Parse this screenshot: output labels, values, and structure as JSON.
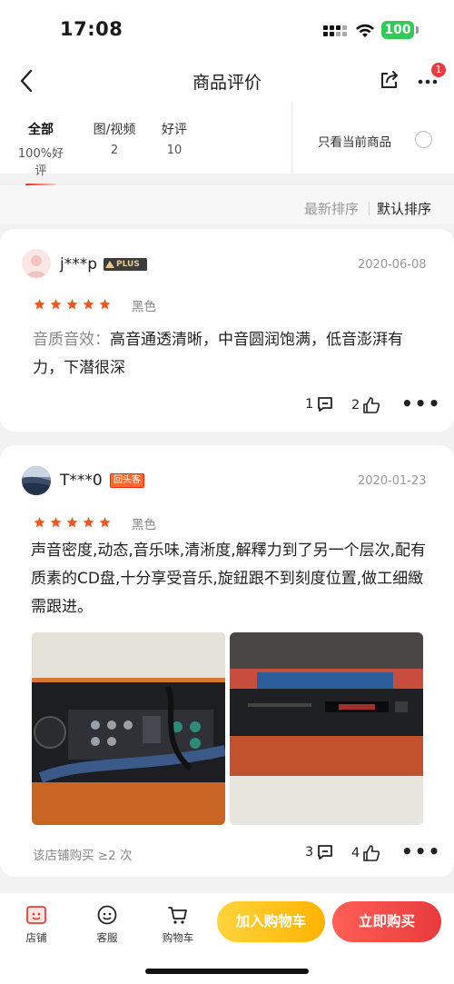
{
  "status": {
    "time": "17:08",
    "battery": "100"
  },
  "nav": {
    "title": "商品评价",
    "badge": "1"
  },
  "filters": {
    "tabs": [
      {
        "label": "全部",
        "count": "100%好评"
      },
      {
        "label": "图/视频",
        "count": "2"
      },
      {
        "label": "好评",
        "count": "10"
      }
    ],
    "only_current": "只看当前商品"
  },
  "sort": {
    "latest": "最新排序",
    "default": "默认排序"
  },
  "reviews": [
    {
      "user": "j***p",
      "badge": "PLUS",
      "date": "2020-06-08",
      "rating": 5,
      "color": "黑色",
      "content_prefix": "音质音效：",
      "content": "高音通透清晰，中音圆润饱满，低音澎湃有力，下潜很深",
      "comments": "1",
      "likes": "2"
    },
    {
      "user": "T***0",
      "badge": "回头客",
      "date": "2020-01-23",
      "rating": 5,
      "color": "黑色",
      "content": "声音密度,动态,音乐味,清淅度,解釋力到了另一个层次,配有质素的CD盘,十分享受音乐,旋鈕跟不到刻度位置,做工细緻需跟进。",
      "buy_note": "该店铺购买 ≥2 次",
      "comments": "3",
      "likes": "4"
    }
  ],
  "bottom": {
    "shop": "店铺",
    "service": "客服",
    "cart": "购物车",
    "add_cart": "加入购物车",
    "buy_now": "立即购买"
  },
  "colors": {
    "brand_red": "#e93b3d",
    "star": "#f2561f",
    "cart_yellow": "#ffc21a"
  }
}
